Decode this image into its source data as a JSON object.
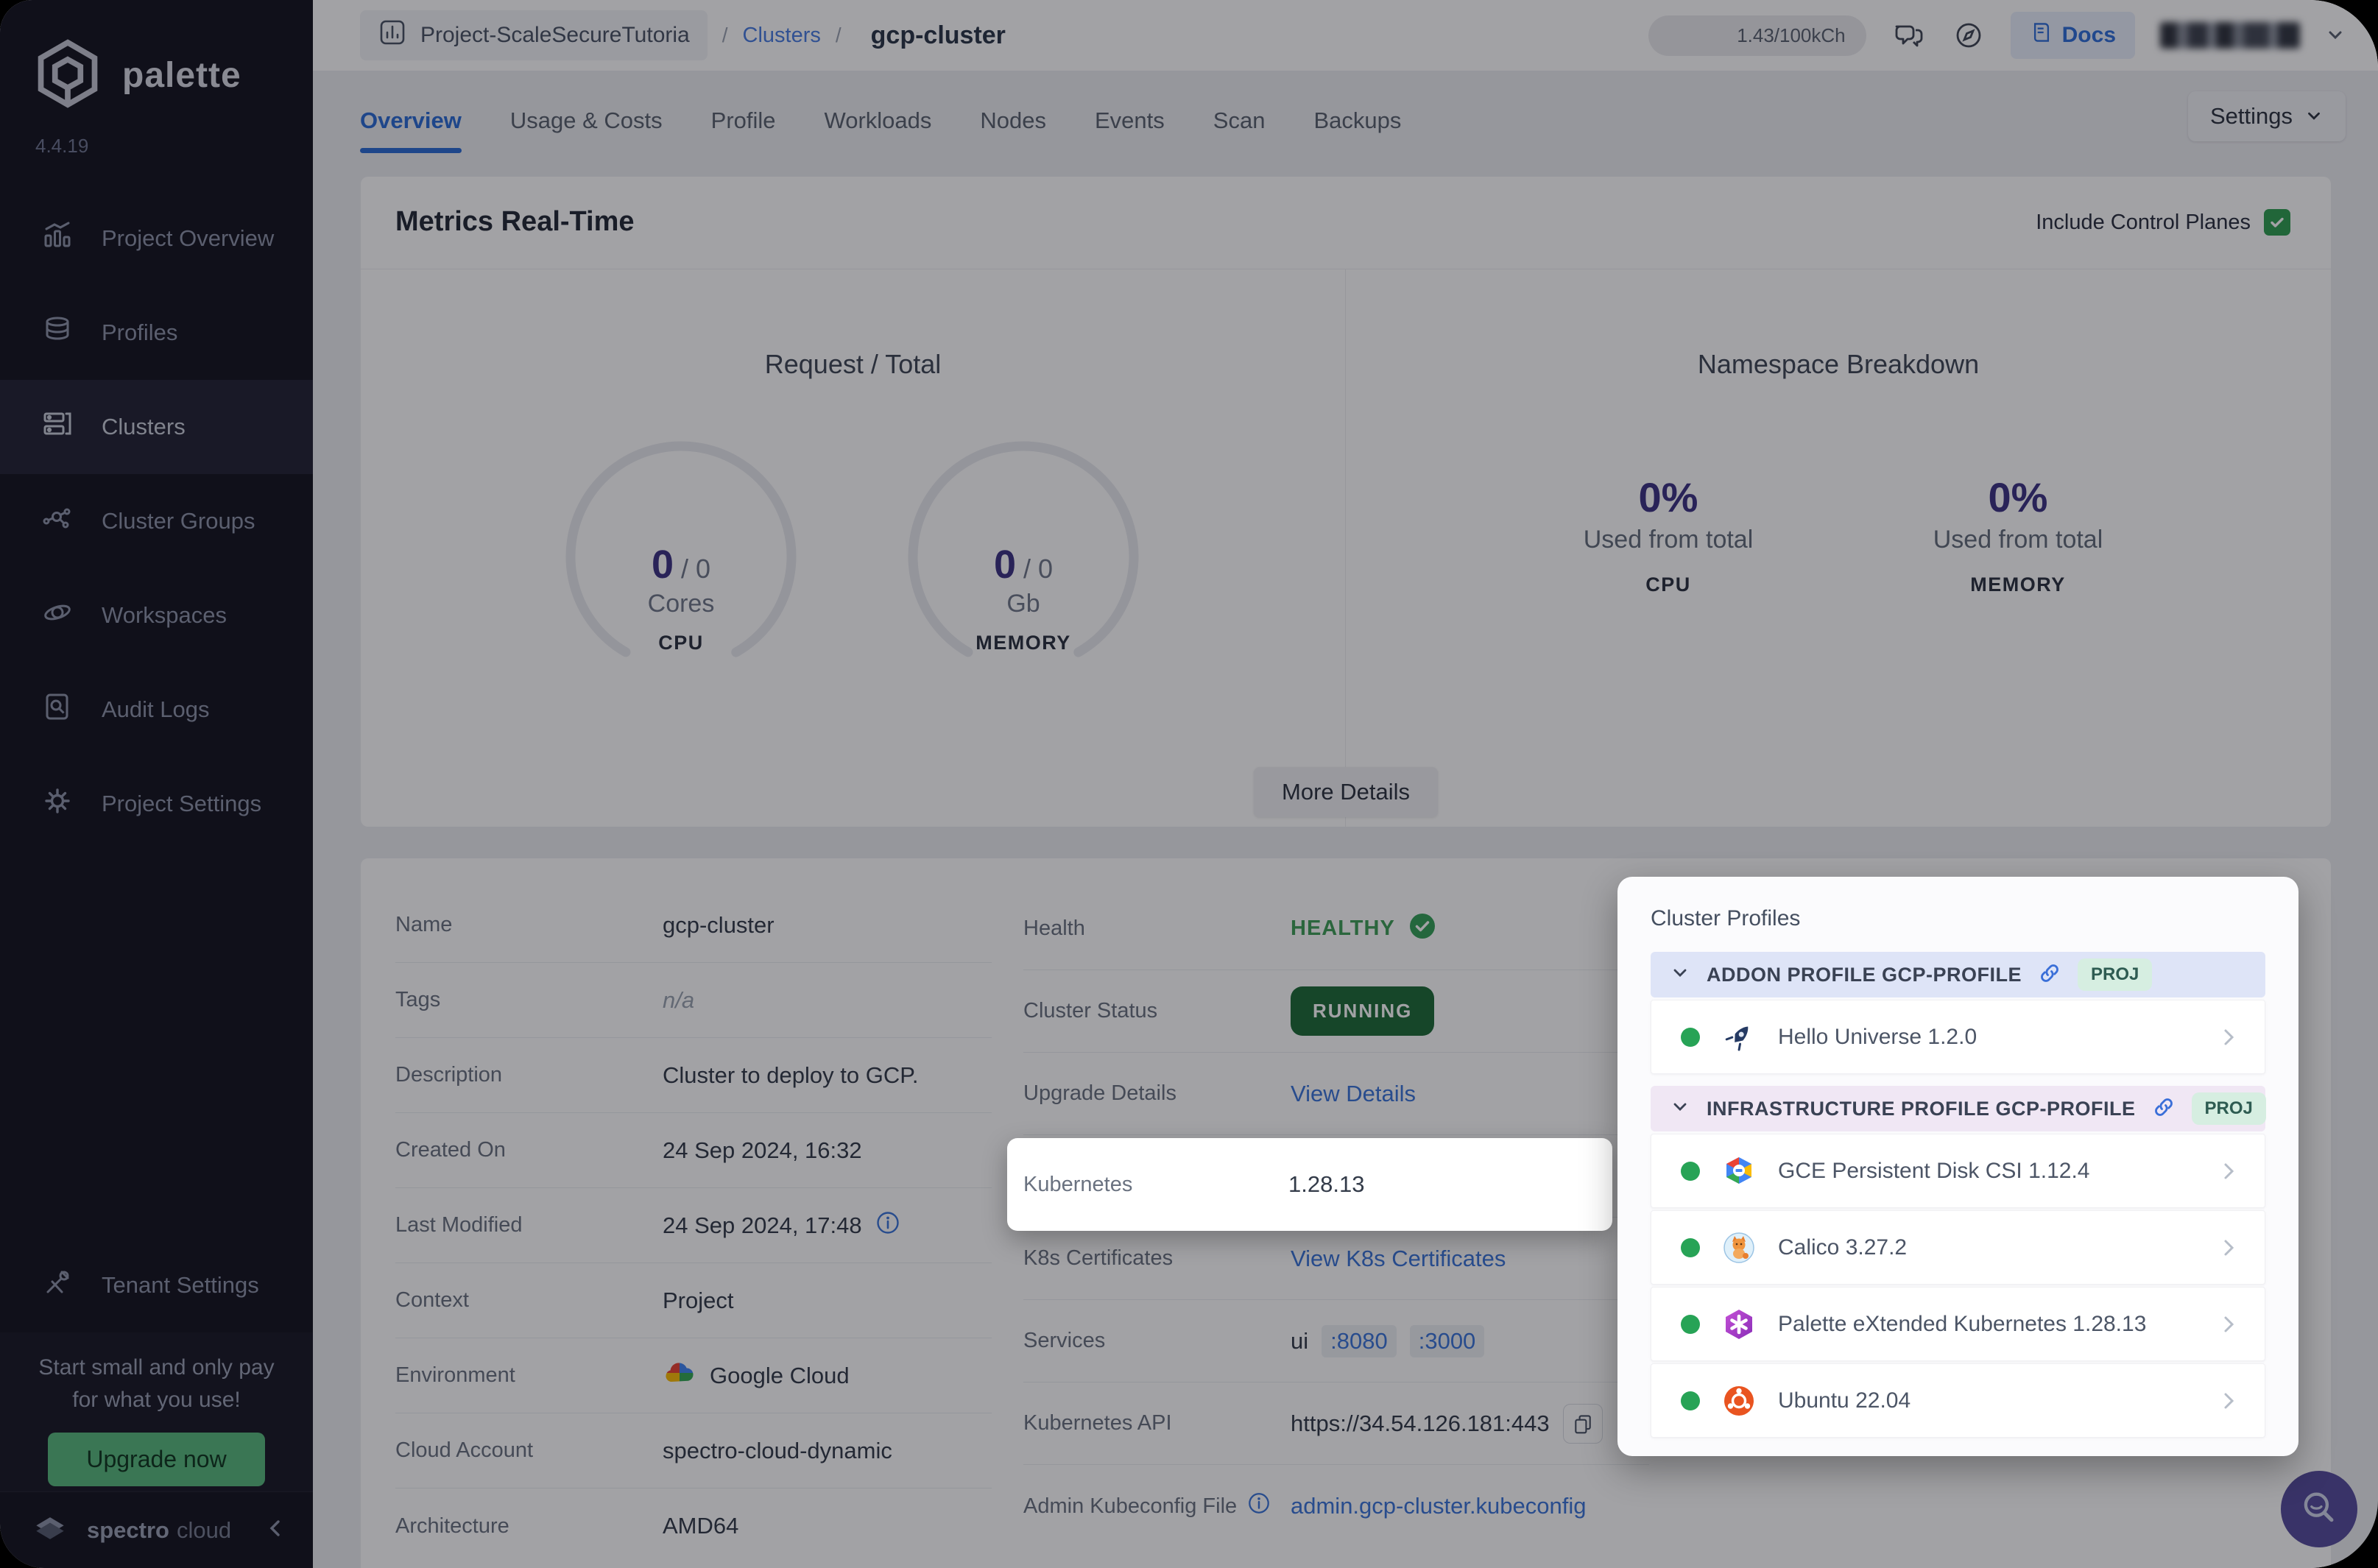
{
  "sidebar": {
    "brand": "palette",
    "version": "4.4.19",
    "items": [
      {
        "label": "Project Overview",
        "icon": "chart-icon",
        "active": false
      },
      {
        "label": "Profiles",
        "icon": "layers-icon",
        "active": false
      },
      {
        "label": "Clusters",
        "icon": "server-icon",
        "active": true
      },
      {
        "label": "Cluster Groups",
        "icon": "network-icon",
        "active": false
      },
      {
        "label": "Workspaces",
        "icon": "orbit-icon",
        "active": false
      },
      {
        "label": "Audit Logs",
        "icon": "audit-icon",
        "active": false
      },
      {
        "label": "Project Settings",
        "icon": "gear-icon",
        "active": false
      }
    ],
    "tenant_settings": "Tenant Settings",
    "promo": {
      "line1": "Start small and only pay",
      "line2": "for what you use!",
      "cta": "Upgrade now"
    },
    "footer": {
      "brand_bold": "spectro",
      "brand_light": "cloud"
    }
  },
  "header": {
    "project_selector": "Project-ScaleSecureTutoria",
    "breadcrumb": {
      "separator": "/",
      "section": "Clusters",
      "current": "gcp-cluster"
    },
    "usage_badge": "1.43/100kCh",
    "docs_button": "Docs"
  },
  "tabs": {
    "items": [
      "Overview",
      "Usage & Costs",
      "Profile",
      "Workloads",
      "Nodes",
      "Events",
      "Scan",
      "Backups"
    ],
    "active": "Overview",
    "settings_button": "Settings"
  },
  "metrics_card": {
    "title": "Metrics Real-Time",
    "include_control_planes_label": "Include Control Planes",
    "request_total": {
      "title": "Request / Total",
      "cpu": {
        "used": "0",
        "sep": "/",
        "total": "0",
        "unit": "Cores",
        "caption": "CPU"
      },
      "memory": {
        "used": "0",
        "sep": "/",
        "total": "0",
        "unit": "Gb",
        "caption": "MEMORY"
      }
    },
    "namespace_breakdown": {
      "title": "Namespace Breakdown",
      "cpu": {
        "percent": "0%",
        "caption": "Used from total",
        "label": "CPU"
      },
      "memory": {
        "percent": "0%",
        "caption": "Used from total",
        "label": "MEMORY"
      }
    },
    "more_details_button": "More Details"
  },
  "details_card": {
    "left_rows": [
      {
        "label": "Name",
        "value": "gcp-cluster"
      },
      {
        "label": "Tags",
        "value": "n/a"
      },
      {
        "label": "Description",
        "value": "Cluster to deploy to GCP."
      },
      {
        "label": "Created On",
        "value": "24 Sep 2024, 16:32"
      },
      {
        "label": "Last Modified",
        "value": "24 Sep 2024, 17:48"
      },
      {
        "label": "Context",
        "value": "Project"
      },
      {
        "label": "Environment",
        "value": "Google Cloud"
      },
      {
        "label": "Cloud Account",
        "value": "spectro-cloud-dynamic"
      },
      {
        "label": "Architecture",
        "value": "AMD64"
      }
    ],
    "right_rows": {
      "health": {
        "label": "Health",
        "value": "HEALTHY"
      },
      "cluster_status": {
        "label": "Cluster Status",
        "value": "RUNNING"
      },
      "upgrade_details": {
        "label": "Upgrade Details",
        "value": "View Details"
      },
      "kubernetes": {
        "label": "Kubernetes",
        "value": "1.28.13"
      },
      "k8s_certificates": {
        "label": "K8s Certificates",
        "value": "View K8s Certificates"
      },
      "services": {
        "label": "Services",
        "value": "ui",
        "ports": [
          ":8080",
          ":3000"
        ]
      },
      "kubernetes_api": {
        "label": "Kubernetes API",
        "value": "https://34.54.126.181:443"
      },
      "admin_kubeconfig": {
        "label": "Admin Kubeconfig File",
        "value": "admin.gcp-cluster.kubeconfig"
      }
    }
  },
  "profiles_panel": {
    "title": "Cluster Profiles",
    "sections": [
      {
        "header": "ADDON PROFILE GCP-PROFILE",
        "badge": "PROJ",
        "items": [
          {
            "name": "Hello Universe 1.2.0",
            "icon": "rocket-icon"
          }
        ]
      },
      {
        "header": "INFRASTRUCTURE PROFILE GCP-PROFILE",
        "badge": "PROJ",
        "items": [
          {
            "name": "GCE Persistent Disk CSI 1.12.4",
            "icon": "gce-icon"
          },
          {
            "name": "Calico 3.27.2",
            "icon": "calico-icon"
          },
          {
            "name": "Palette eXtended Kubernetes 1.28.13",
            "icon": "pxk-icon"
          },
          {
            "name": "Ubuntu 22.04",
            "icon": "ubuntu-icon"
          }
        ]
      }
    ]
  },
  "colors": {
    "accent_blue": "#2f6fd8",
    "metric_purple": "#3d3383",
    "healthy_green": "#3f9e58",
    "running_green_bg": "#1e6b37",
    "status_dot_green": "#27a356",
    "sidebar_bg": "#14141f",
    "upgrade_green": "#57b97c",
    "fab_purple": "#564c9d",
    "addon_header_bg": "#dee4f7",
    "infra_header_bg": "#f0e7f4",
    "proj_badge_bg": "#d6eee1"
  }
}
